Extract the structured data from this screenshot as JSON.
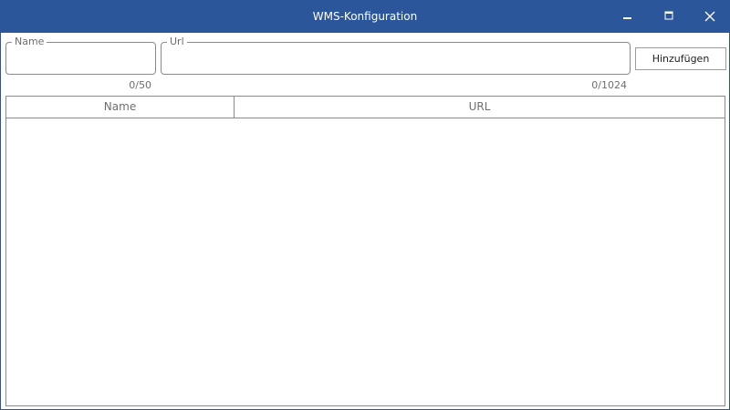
{
  "window": {
    "title": "WMS-Konfiguration",
    "controls": {
      "minimize_icon": "minimize-icon",
      "maximize_icon": "maximize-icon",
      "close_icon": "close-icon"
    },
    "accent_color": "#2b579a"
  },
  "form": {
    "name_field": {
      "label": "Name",
      "value": "",
      "counter": "0/50"
    },
    "url_field": {
      "label": "Url",
      "value": "",
      "counter": "0/1024"
    },
    "add_button_label": "Hinzufügen"
  },
  "table": {
    "columns": [
      "Name",
      "URL"
    ],
    "rows": []
  }
}
